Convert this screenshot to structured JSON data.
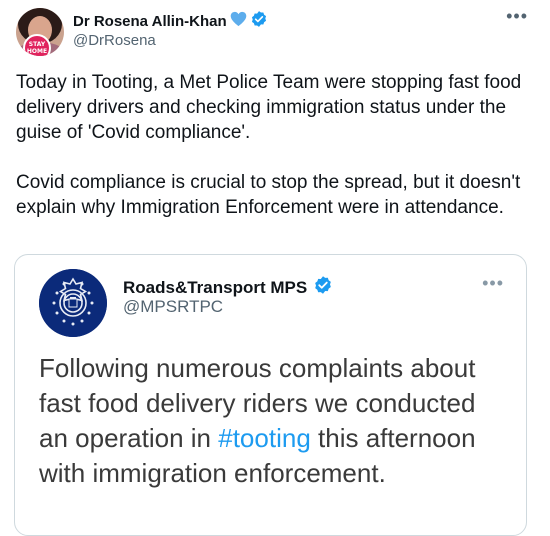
{
  "tweet": {
    "author_name": "Dr Rosena Allin-Khan",
    "author_handle": "@DrRosena",
    "avatar_badge_text": "STAY HOME",
    "more_icon": "more-horizontal-icon",
    "text": "Today in Tooting, a Met Police Team were stopping fast food delivery drivers and checking immigration status under the guise of 'Covid compliance'.\n\nCovid compliance is crucial to stop the spread, but it doesn't explain why Immigration Enforcement were in attendance."
  },
  "quoted_tweet": {
    "author_name": "Roads&Transport MPS",
    "author_handle": "@MPSRTPC",
    "more_icon": "more-horizontal-icon",
    "text_before_hashtag": "Following numerous complaints about fast food delivery riders we conducted an operation in ",
    "hashtag": "#tooting",
    "text_after_hashtag": " this afternoon with immigration enforcement."
  },
  "colors": {
    "verified_badge": "#1d9bf0",
    "heart_emoji": "#5dadec",
    "link": "#1d9bf0",
    "met_police_blue": "#0b2a7a"
  }
}
